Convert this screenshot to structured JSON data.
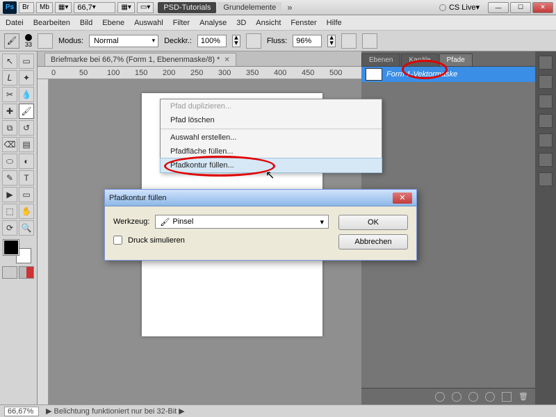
{
  "titlebar": {
    "logo_text": "Ps",
    "buttons": [
      "Br",
      "Mb"
    ],
    "zoom": "66,7",
    "workspace_primary": "PSD-Tutorials",
    "workspace_secondary": "Grundelemente",
    "cslive": "CS Live"
  },
  "menu": [
    "Datei",
    "Bearbeiten",
    "Bild",
    "Ebene",
    "Auswahl",
    "Filter",
    "Analyse",
    "3D",
    "Ansicht",
    "Fenster",
    "Hilfe"
  ],
  "options": {
    "brush_size_label": "33",
    "mode_label": "Modus:",
    "mode_value": "Normal",
    "opacity_label": "Deckkr.:",
    "opacity_value": "100%",
    "flow_label": "Fluss:",
    "flow_value": "96%"
  },
  "document": {
    "tab_title": "Briefmarke bei 66,7% (Form 1, Ebenenmaske/8) *"
  },
  "ruler_marks": [
    "0",
    "50",
    "100",
    "150",
    "200",
    "250",
    "300",
    "350",
    "400",
    "450",
    "500"
  ],
  "panels": {
    "tabs": [
      "Ebenen",
      "Kanäle",
      "Pfade"
    ],
    "active_tab_index": 2,
    "path_item": "Form 1-Vektormaske"
  },
  "context_menu": {
    "items": [
      {
        "label": "Pfad duplizieren...",
        "disabled": true
      },
      {
        "label": "Pfad löschen"
      },
      {
        "sep": true
      },
      {
        "label": "Auswahl erstellen..."
      },
      {
        "label": "Pfadfläche füllen..."
      },
      {
        "label": "Pfadkontur füllen...",
        "hover": true
      }
    ]
  },
  "dialog": {
    "title": "Pfadkontur füllen",
    "tool_label": "Werkzeug:",
    "tool_value": "Pinsel",
    "simulate_label": "Druck simulieren",
    "ok": "OK",
    "cancel": "Abbrechen"
  },
  "status": {
    "zoom": "66,67%",
    "message": "Belichtung funktioniert nur bei 32-Bit"
  }
}
